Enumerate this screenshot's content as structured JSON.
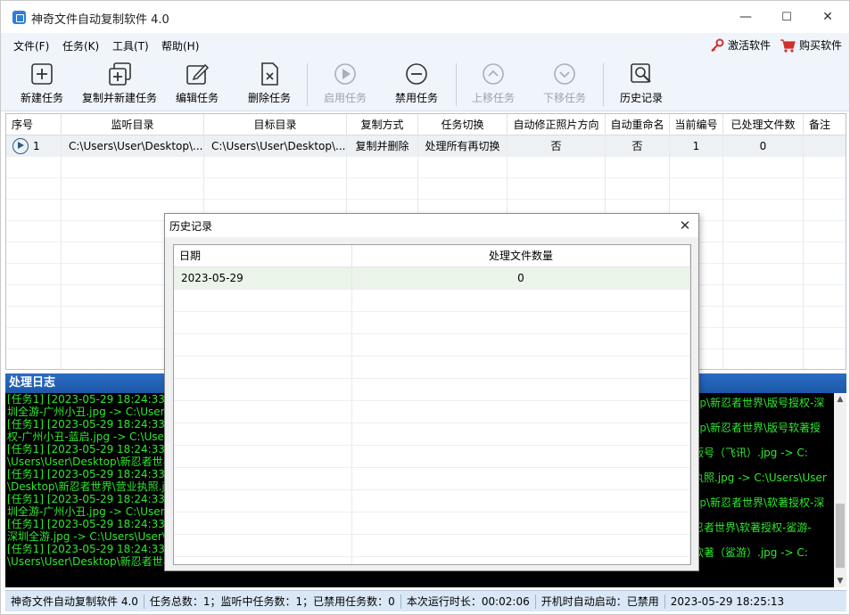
{
  "window": {
    "title": "神奇文件自动复制软件 4.0",
    "minimize": "—",
    "maximize": "☐",
    "close": "✕"
  },
  "menu": {
    "items": [
      "文件(F)",
      "任务(K)",
      "工具(T)",
      "帮助(H)"
    ],
    "activate": "激活软件",
    "buy": "购买软件"
  },
  "toolbar": {
    "new_task": "新建任务",
    "copy_new_task": "复制并新建任务",
    "edit_task": "编辑任务",
    "delete_task": "删除任务",
    "enable_task": "启用任务",
    "disable_task": "禁用任务",
    "move_up": "上移任务",
    "move_down": "下移任务",
    "history": "历史记录"
  },
  "task_grid": {
    "columns": [
      "序号",
      "监听目录",
      "目标目录",
      "复制方式",
      "任务切换",
      "自动修正照片方向",
      "自动重命名",
      "当前编号",
      "已处理文件数",
      "备注"
    ],
    "rows": [
      {
        "index": "1",
        "watch_dir": "C:\\Users\\User\\Desktop\\...",
        "target_dir": "C:\\Users\\User\\Desktop\\...",
        "copy_mode": "复制并删除",
        "switch": "处理所有再切换",
        "fix_orientation": "否",
        "auto_rename": "否",
        "current_number": "1",
        "processed": "0",
        "note": ""
      }
    ]
  },
  "log": {
    "title": "处理日志",
    "left_lines": [
      "[任务1] [2023-05-29 18:24:33]",
      "圳全游-广州小丑.jpg -> C:\\Users",
      "[任务1] [2023-05-29 18:24:33]",
      "权-广州小丑-蓝启.jpg -> C:\\Users",
      "[任务1] [2023-05-29 18:24:33]",
      "\\Users\\User\\Desktop\\新忍者世界",
      "[任务1] [2023-05-29 18:24:33]",
      "\\Desktop\\新忍者世界\\营业执照.j",
      "[任务1] [2023-05-29 18:24:33]",
      "圳全游-广州小丑.jpg -> C:\\Users",
      "[任务1] [2023-05-29 18:24:33]",
      "深圳全游.jpg -> C:\\Users\\User\\D",
      "[任务1] [2023-05-29 18:24:33]",
      "\\Users\\User\\Desktop\\新忍者世界"
    ],
    "right_lines": [
      "op\\新忍者世界\\版号授权-深",
      "",
      "op\\新忍者世界\\版号软著授",
      "",
      "版号（飞讯）.jpg -> C:",
      "",
      "执照.jpg -> C:\\Users\\User",
      "",
      "op\\新忍者世界\\软著授权-深",
      "",
      "忍者世界\\软著授权-鲨游-",
      "",
      "软著（鲨游）.jpg -> C:",
      ""
    ]
  },
  "status": {
    "app": "神奇文件自动复制软件 4.0",
    "task_total": "任务总数：1；监听中任务数：1；已禁用任务数：0",
    "runtime": "本次运行时长：00:02:06",
    "autostart": "开机时自动启动：已禁用",
    "datetime": "2023-05-29 18:25:13"
  },
  "history_dialog": {
    "title": "历史记录",
    "close": "✕",
    "columns": [
      "日期",
      "处理文件数量"
    ],
    "rows": [
      {
        "date": "2023-05-29",
        "count": "0"
      }
    ]
  },
  "colors": {
    "accent": "#1d58a8",
    "log_text": "#2ee82e",
    "statusbar": "#d9e7f6"
  }
}
